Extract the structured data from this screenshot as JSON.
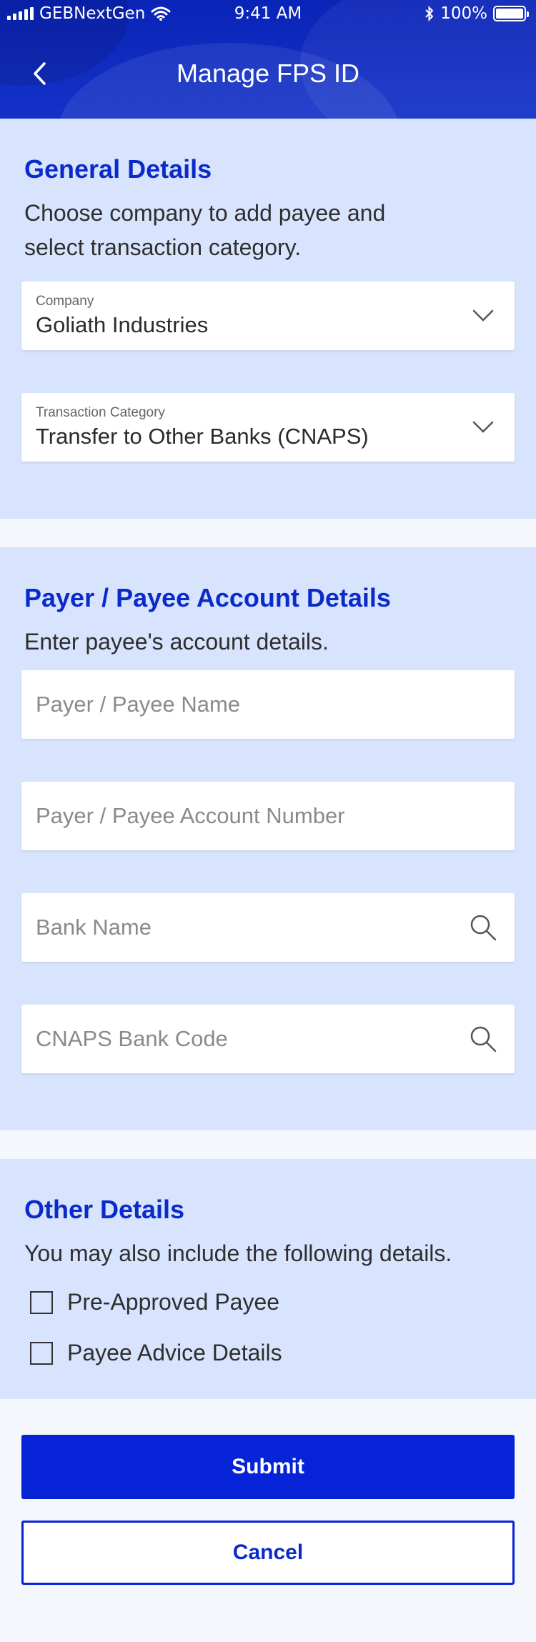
{
  "status_bar": {
    "carrier": "GEBNextGen",
    "time": "9:41 AM",
    "battery": "100%"
  },
  "header": {
    "title": "Manage FPS ID",
    "back_icon": "chevron-left-icon"
  },
  "general": {
    "title": "General Details",
    "description": "Choose company to add payee and select transaction category.",
    "company": {
      "label": "Company",
      "value": "Goliath Industries"
    },
    "category": {
      "label": "Transaction Category",
      "value": "Transfer to Other Banks (CNAPS)"
    }
  },
  "account": {
    "title": "Payer / Payee Account Details",
    "description": "Enter payee's account details.",
    "name_placeholder": "Payer / Payee Name",
    "account_number_placeholder": "Payer / Payee Account Number",
    "bank_name_placeholder": "Bank Name",
    "cnaps_code_placeholder": "CNAPS Bank Code"
  },
  "other": {
    "title": "Other Details",
    "description": "You may also include the following details.",
    "options": [
      {
        "label": "Pre-Approved Payee",
        "checked": false
      },
      {
        "label": "Payee Advice Details",
        "checked": false
      }
    ]
  },
  "actions": {
    "submit": "Submit",
    "cancel": "Cancel"
  },
  "colors": {
    "brand": "#0623d8",
    "section_bg": "#d8e4fd",
    "title": "#0a2bc9"
  }
}
